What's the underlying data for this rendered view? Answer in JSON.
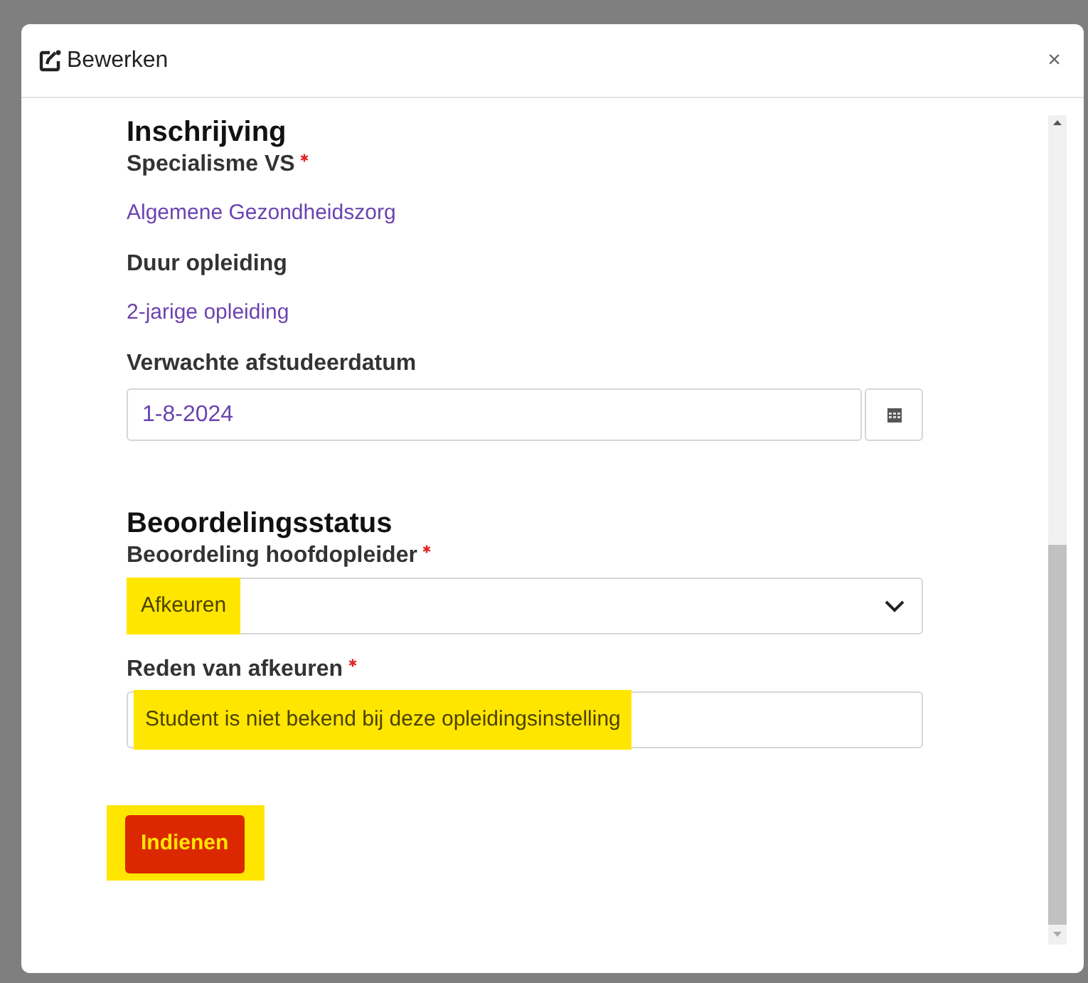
{
  "dialog": {
    "title": "Bewerken",
    "close": "×"
  },
  "sections": [
    {
      "heading": "Inschrijving",
      "fields": [
        {
          "kind": "text",
          "label": "Specialisme VS",
          "required": true,
          "value": "Algemene Gezondheidszorg"
        },
        {
          "kind": "text",
          "label": "Duur opleiding",
          "required": false,
          "value": "2-jarige opleiding"
        },
        {
          "kind": "date",
          "label": "Verwachte afstudeerdatum",
          "required": false,
          "value": "1-8-2024"
        }
      ]
    },
    {
      "heading": "Beoordelingsstatus",
      "fields": [
        {
          "kind": "select",
          "label": "Beoordeling hoofdopleider",
          "required": true,
          "value": "Afkeuren",
          "highlighted": true
        },
        {
          "kind": "input",
          "label": "Reden van afkeuren",
          "required": true,
          "value": "Student is niet bekend bij deze opleidingsinstelling",
          "highlighted": true
        }
      ]
    }
  ],
  "submit": {
    "label": "Indienen",
    "highlighted": true
  }
}
